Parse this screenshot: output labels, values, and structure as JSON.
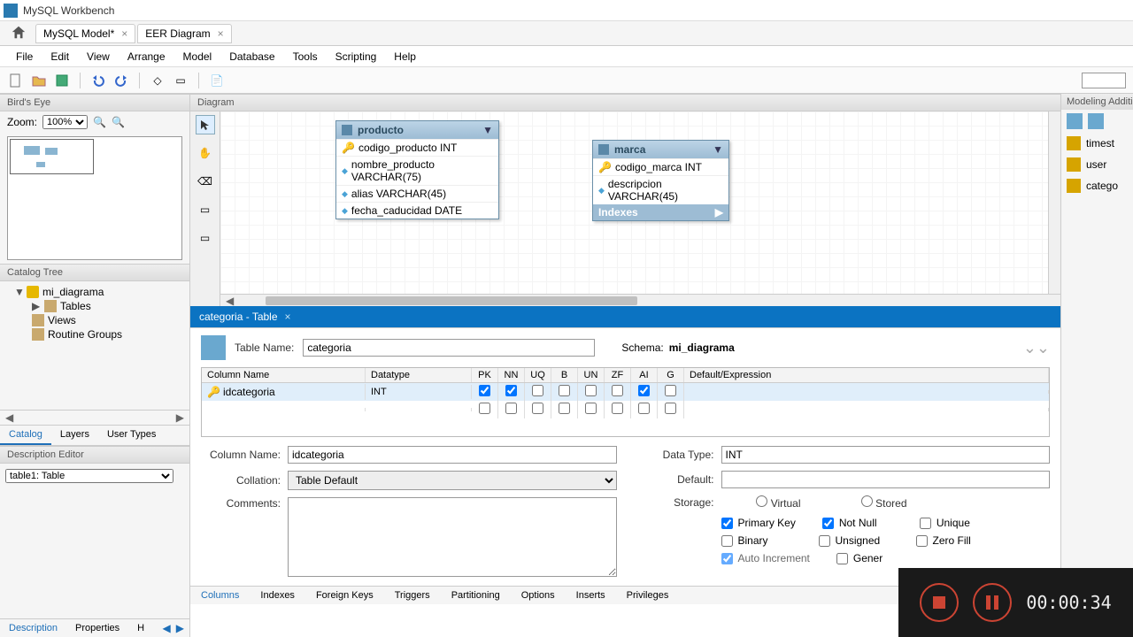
{
  "app_title": "MySQL Workbench",
  "doc_tabs": [
    "MySQL Model*",
    "EER Diagram"
  ],
  "menus": [
    "File",
    "Edit",
    "View",
    "Arrange",
    "Model",
    "Database",
    "Tools",
    "Scripting",
    "Help"
  ],
  "left": {
    "birds_eye": "Bird's Eye",
    "zoom_label": "Zoom:",
    "zoom_value": "100%",
    "catalog_tree": "Catalog Tree",
    "db": "mi_diagrama",
    "nodes": [
      "Tables",
      "Views",
      "Routine Groups"
    ],
    "tabs": [
      "Catalog",
      "Layers",
      "User Types"
    ],
    "desc_editor": "Description Editor",
    "desc_value": "table1: Table",
    "bottom_tabs": [
      "Description",
      "Properties",
      "H"
    ]
  },
  "diagram": {
    "header": "Diagram",
    "producto": {
      "name": "producto",
      "cols": [
        "codigo_producto INT",
        "nombre_producto VARCHAR(75)",
        "alias VARCHAR(45)",
        "fecha_caducidad DATE"
      ]
    },
    "marca": {
      "name": "marca",
      "cols": [
        "codigo_marca INT",
        "descripcion VARCHAR(45)"
      ],
      "indexes": "Indexes"
    }
  },
  "editor_tab": "categoria - Table",
  "editor": {
    "table_name_label": "Table Name:",
    "table_name": "categoria",
    "schema_label": "Schema:",
    "schema": "mi_diagrama",
    "grid_headers": [
      "Column Name",
      "Datatype",
      "PK",
      "NN",
      "UQ",
      "B",
      "UN",
      "ZF",
      "AI",
      "G",
      "Default/Expression"
    ],
    "row": {
      "name": "idcategoria",
      "type": "INT",
      "pk": true,
      "nn": true,
      "uq": false,
      "b": false,
      "un": false,
      "zf": false,
      "ai": true,
      "g": false,
      "def": ""
    },
    "column_name_label": "Column Name:",
    "column_name": "idcategoria",
    "collation_label": "Collation:",
    "collation": "Table Default",
    "comments_label": "Comments:",
    "datatype_label": "Data Type:",
    "datatype": "INT",
    "default_label": "Default:",
    "storage_label": "Storage:",
    "virtual": "Virtual",
    "stored": "Stored",
    "chk_pk": "Primary Key",
    "chk_nn": "Not Null",
    "chk_uq": "Unique",
    "chk_bin": "Binary",
    "chk_un": "Unsigned",
    "chk_zf": "Zero Fill",
    "chk_ai": "Auto Increment",
    "chk_gen": "Gener",
    "bottom_tabs": [
      "Columns",
      "Indexes",
      "Foreign Keys",
      "Triggers",
      "Partitioning",
      "Options",
      "Inserts",
      "Privileges"
    ]
  },
  "right": {
    "header": "Modeling Additi",
    "items": [
      "timest",
      "user",
      "catego"
    ]
  },
  "recorder_time": "00:00:34"
}
